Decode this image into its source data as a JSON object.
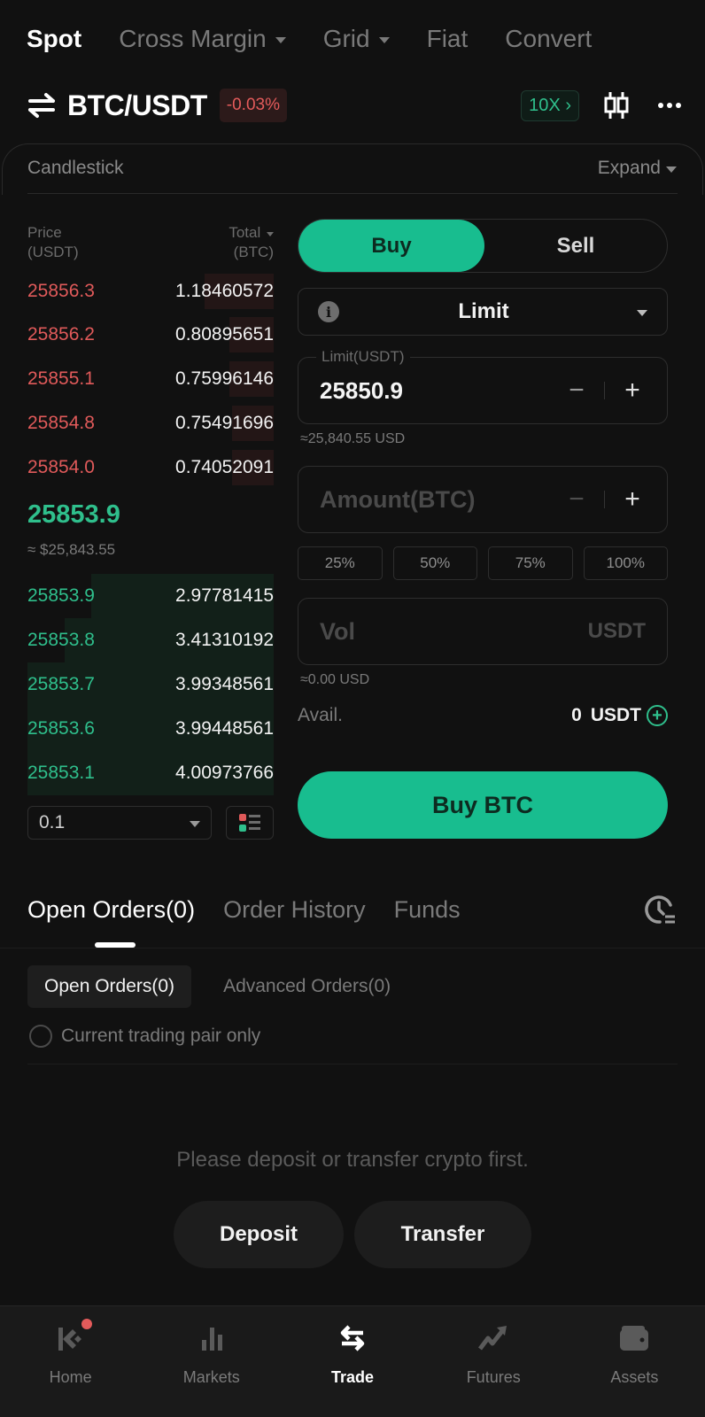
{
  "top_tabs": [
    {
      "label": "Spot",
      "active": true,
      "dropdown": false
    },
    {
      "label": "Cross Margin",
      "active": false,
      "dropdown": true
    },
    {
      "label": "Grid",
      "active": false,
      "dropdown": true
    },
    {
      "label": "Fiat",
      "active": false,
      "dropdown": false
    },
    {
      "label": "Convert",
      "active": false,
      "dropdown": false
    }
  ],
  "pair": {
    "name": "BTC/USDT",
    "change": "-0.03%",
    "leverage": "10X",
    "icons": [
      "swap-icon",
      "candlestick-chart-icon",
      "more-icon"
    ]
  },
  "chart_panel": {
    "label": "Candlestick",
    "expand_label": "Expand"
  },
  "orderbook": {
    "header": {
      "price_line1": "Price",
      "price_line2": "(USDT)",
      "total_line1": "Total",
      "total_line2": "(BTC)"
    },
    "asks": [
      {
        "price": "25856.3",
        "total": "1.18460572",
        "depth": 0.28
      },
      {
        "price": "25856.2",
        "total": "0.80895651",
        "depth": 0.18
      },
      {
        "price": "25855.1",
        "total": "0.75996146",
        "depth": 0.18
      },
      {
        "price": "25854.8",
        "total": "0.75491696",
        "depth": 0.17
      },
      {
        "price": "25854.0",
        "total": "0.74052091",
        "depth": 0.17
      }
    ],
    "last_price": "25853.9",
    "last_price_usd": "≈ $25,843.55",
    "bids": [
      {
        "price": "25853.9",
        "total": "2.97781415",
        "depth": 0.74
      },
      {
        "price": "25853.8",
        "total": "3.41310192",
        "depth": 0.85
      },
      {
        "price": "25853.7",
        "total": "3.99348561",
        "depth": 1.0
      },
      {
        "price": "25853.6",
        "total": "3.99448561",
        "depth": 1.0
      },
      {
        "price": "25853.1",
        "total": "4.00973766",
        "depth": 1.0
      }
    ],
    "precision": "0.1"
  },
  "trade_form": {
    "buy_label": "Buy",
    "sell_label": "Sell",
    "order_type": "Limit",
    "limit_legend": "Limit(USDT)",
    "limit_value": "25850.9",
    "limit_approx": "≈25,840.55 USD",
    "amount_placeholder": "Amount(BTC)",
    "percent_options": [
      "25%",
      "50%",
      "75%",
      "100%"
    ],
    "vol_placeholder": "Vol",
    "vol_unit": "USDT",
    "vol_approx": "≈0.00 USD",
    "avail_label": "Avail.",
    "avail_value": "0",
    "avail_unit": "USDT",
    "submit_label": "Buy BTC",
    "minus": "−",
    "plus": "+"
  },
  "orders": {
    "tabs": [
      {
        "label": "Open Orders(0)",
        "active": true
      },
      {
        "label": "Order History",
        "active": false
      },
      {
        "label": "Funds",
        "active": false
      }
    ],
    "sub_tabs": [
      {
        "label": "Open Orders(0)",
        "active": true
      },
      {
        "label": "Advanced Orders(0)",
        "active": false
      }
    ],
    "pair_only_label": "Current trading pair only",
    "empty_message": "Please deposit or transfer crypto first.",
    "deposit_label": "Deposit",
    "transfer_label": "Transfer"
  },
  "bottom_nav": [
    {
      "label": "Home",
      "icon": "home-logo-icon",
      "active": false,
      "badge": true
    },
    {
      "label": "Markets",
      "icon": "bar-chart-icon",
      "active": false,
      "badge": false
    },
    {
      "label": "Trade",
      "icon": "trade-swap-icon",
      "active": true,
      "badge": false
    },
    {
      "label": "Futures",
      "icon": "trend-up-icon",
      "active": false,
      "badge": false
    },
    {
      "label": "Assets",
      "icon": "wallet-icon",
      "active": false,
      "badge": false
    }
  ],
  "colors": {
    "background": "#111111",
    "accent_green": "#18bd8f",
    "up_green": "#2fbf8c",
    "down_red": "#e05a5a"
  }
}
